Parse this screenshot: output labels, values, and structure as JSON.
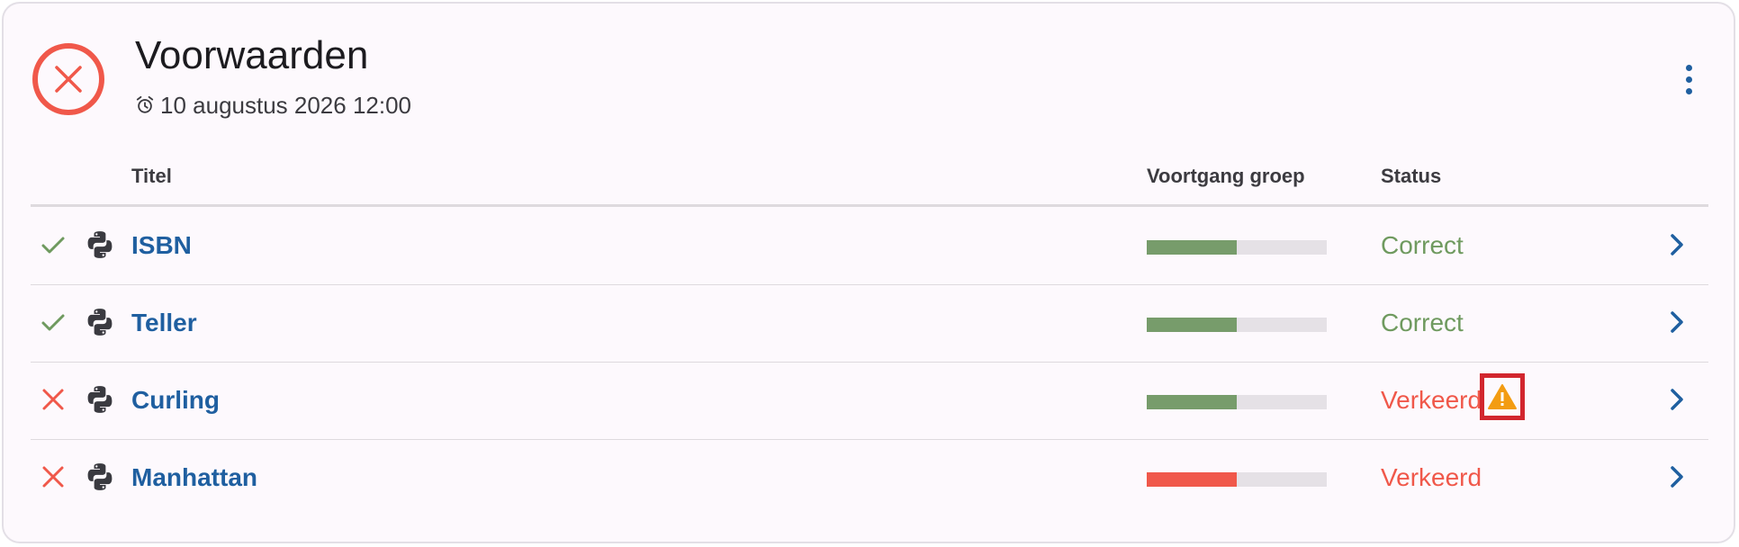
{
  "card": {
    "title": "Voorwaarden",
    "deadline": "10 augustus 2026 12:00",
    "status_icon": "close-icon",
    "menu_icon": "more-vertical-icon"
  },
  "table": {
    "headers": {
      "title": "Titel",
      "progress": "Voortgang groep",
      "status": "Status"
    },
    "rows": [
      {
        "result": "correct",
        "language_icon": "python-icon",
        "title": "ISBN",
        "progress": 0.5,
        "progress_color": "#779c6b",
        "status": "Correct",
        "status_color": "#6f9a5f",
        "warning": false
      },
      {
        "result": "correct",
        "language_icon": "python-icon",
        "title": "Teller",
        "progress": 0.5,
        "progress_color": "#779c6b",
        "status": "Correct",
        "status_color": "#6f9a5f",
        "warning": false
      },
      {
        "result": "wrong",
        "language_icon": "python-icon",
        "title": "Curling",
        "progress": 0.5,
        "progress_color": "#779c6b",
        "status": "Verkeerd",
        "status_color": "#f0584a",
        "warning": true
      },
      {
        "result": "wrong",
        "language_icon": "python-icon",
        "title": "Manhattan",
        "progress": 0.5,
        "progress_color": "#f0584a",
        "status": "Verkeerd",
        "status_color": "#f0584a",
        "warning": false
      }
    ]
  },
  "colors": {
    "accent": "#1f5fa0",
    "correct": "#6f9a5f",
    "wrong": "#f0584a",
    "warning": "#f39c12",
    "highlight": "#d2262e"
  }
}
